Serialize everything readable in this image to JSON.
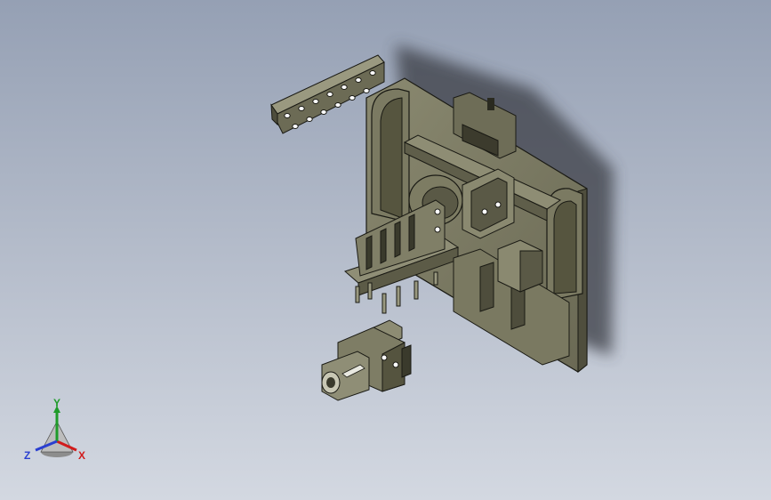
{
  "viewport": {
    "background_top": "#95a0b4",
    "background_bottom": "#d3d8e1",
    "model_color": "#7d7c63",
    "model_edge_color": "#1a1a14",
    "shadow_color": "#3b3e44"
  },
  "triad": {
    "x_label": "X",
    "y_label": "Y",
    "z_label": "Z",
    "x_color": "#d11c1c",
    "y_color": "#1f9b2a",
    "z_color": "#2a3fd0"
  }
}
